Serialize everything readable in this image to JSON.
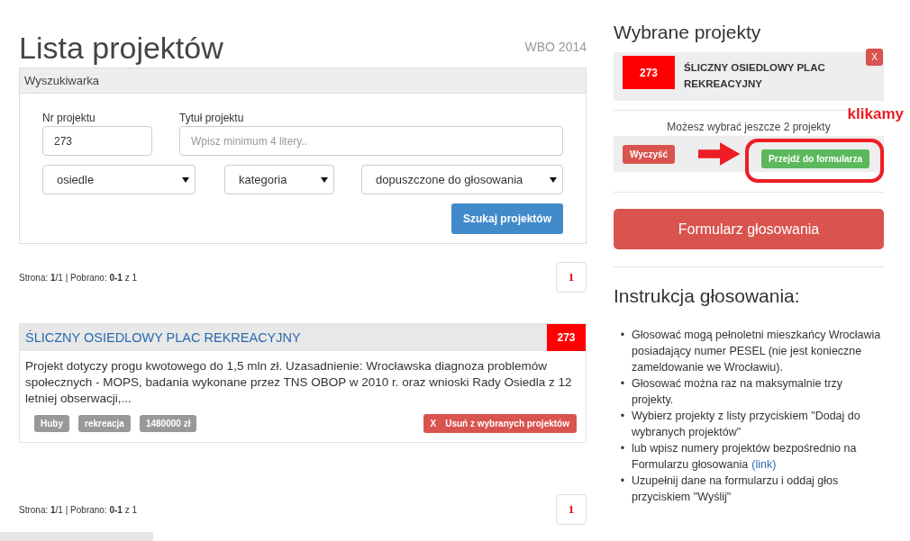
{
  "header": {
    "title": "Lista projektów",
    "edition": "WBO 2014"
  },
  "search": {
    "title": "Wyszukiwarka",
    "number": {
      "label": "Nr projektu",
      "value": "273"
    },
    "name": {
      "label": "Tytuł projektu",
      "placeholder": "Wpisz minimum 4 litery.."
    },
    "selects": [
      "osiedle",
      "kategoria",
      "dopuszczone do głosowania"
    ],
    "button": "Szukaj projektów"
  },
  "pagination_top": {
    "info": "Strona: **1**/1 | Pobrano: **0-1** z 1",
    "pages": [
      {
        "label": "1",
        "selected": true
      }
    ]
  },
  "project": {
    "title": "ŚLICZNY OSIEDLOWY PLAC REKREACYJNY",
    "number": "273",
    "description": "Projekt dotyczy progu kwotowego do 1,5 mln zł. Uzasadnienie: Wrocławska diagnoza problemów społecznych - MOPS, badania wykonane przez TNS OBOP w 2010 r. oraz wnioski Rady Osiedla z 12 letniej obserwacji,...",
    "tags": [
      "Huby",
      "rekreacja",
      "1480000 zł"
    ],
    "remove_button": {
      "icon": "X",
      "label": "Usuń z wybranych projektów"
    }
  },
  "pagination_bottom": {
    "info": "Strona: **1**/1 | Pobrano: **0-1** z 1",
    "pages": [
      {
        "label": "1",
        "selected": true
      }
    ]
  },
  "selected": {
    "title": "Wybrane projekty",
    "items": [
      {
        "number": "273",
        "title": "ŚLICZNY OSIEDLOWY PLAC REKREACYJNY",
        "remove": "X"
      }
    ],
    "remaining": "Możesz wybrać jeszcze 2 projekty",
    "clear_button": "Wyczyść",
    "form_button": "Przejdź do formularza",
    "vote_button": "Formularz głosowania"
  },
  "annotation": {
    "text": "klikamy"
  },
  "instructions": {
    "title": "Instrukcja głosowania:",
    "items": [
      {
        "marker": "•",
        "text": "Głosować mogą pełnoletni mieszkańcy Wrocławia posiadający numer PESEL (nie jest konieczne zameldowanie we Wrocławiu)."
      },
      {
        "marker": "•",
        "text": "Głosować można raz na maksymalnie trzy projekty."
      },
      {
        "marker": "•",
        "text": "Wybierz projekty z listy przyciskiem \"Dodaj do wybranych projektów\""
      },
      {
        "marker": "•",
        "text": "lub wpisz numery projektów bezpośrednio na Formularzu głosowania",
        "link": "(link)"
      },
      {
        "marker": "•",
        "text": "Uzupełnij dane na formularzu i oddaj głos przyciskiem \"Wyślij\""
      }
    ]
  }
}
